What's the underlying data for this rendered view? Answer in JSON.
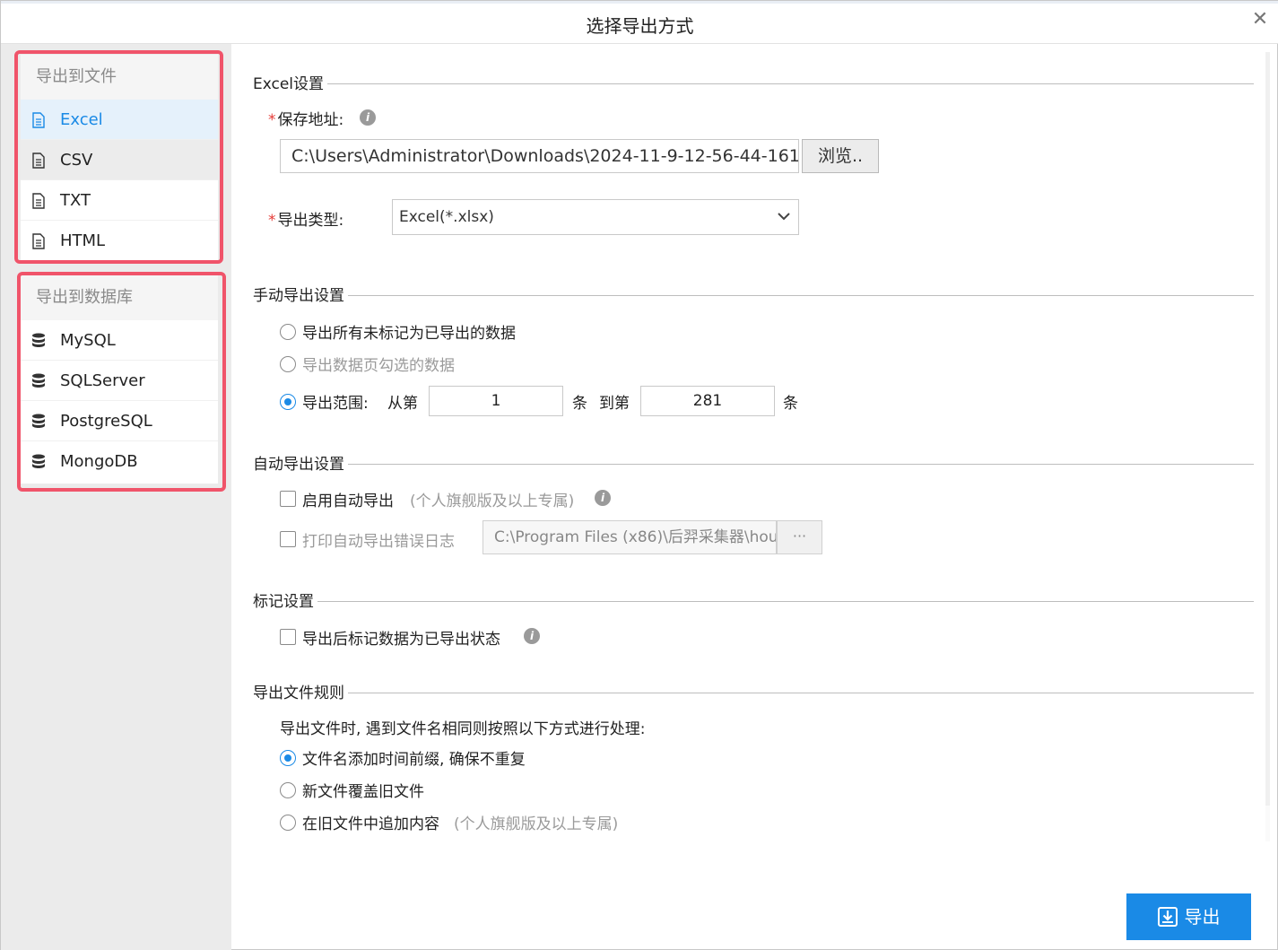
{
  "dialog": {
    "title": "选择导出方式",
    "close_symbol": "✕"
  },
  "sidebar": {
    "file_group": {
      "title": "导出到文件",
      "items": [
        {
          "label": "Excel",
          "icon": "file-icon"
        },
        {
          "label": "CSV",
          "icon": "file-icon"
        },
        {
          "label": "TXT",
          "icon": "file-icon"
        },
        {
          "label": "HTML",
          "icon": "file-icon"
        }
      ]
    },
    "db_group": {
      "title": "导出到数据库",
      "items": [
        {
          "label": "MySQL",
          "icon": "database-icon"
        },
        {
          "label": "SQLServer",
          "icon": "database-icon"
        },
        {
          "label": "PostgreSQL",
          "icon": "database-icon"
        },
        {
          "label": "MongoDB",
          "icon": "database-icon"
        }
      ]
    },
    "highlight_color": "#f0546a"
  },
  "excel_settings": {
    "section_title": "Excel设置",
    "required_mark": "*",
    "save_path_label": "保存地址:",
    "save_path_value": "C:\\Users\\Administrator\\Downloads\\2024-11-9-12-56-44-161",
    "browse_label": "浏览..",
    "export_type_label": "导出类型:",
    "export_type_value": "Excel(*.xlsx)"
  },
  "manual_settings": {
    "section_title": "手动导出设置",
    "option_unmarked": "导出所有未标记为已导出的数据",
    "option_checked": "导出数据页勾选的数据",
    "option_range": "导出范围:",
    "range_from_label": "从第",
    "range_from_value": "1",
    "range_unit": "条",
    "range_to_label": "到第",
    "range_to_value": "281"
  },
  "auto_settings": {
    "section_title": "自动导出设置",
    "enable_label": "启用自动导出",
    "enable_note": "(个人旗舰版及以上专属)",
    "log_label": "打印自动导出错误日志",
    "log_path": "C:\\Program Files (x86)\\后羿采集器\\hou",
    "log_browse": "···"
  },
  "mark_settings": {
    "section_title": "标记设置",
    "mark_label": "导出后标记数据为已导出状态"
  },
  "file_rules": {
    "section_title": "导出文件规则",
    "description": "导出文件时, 遇到文件名相同则按照以下方式进行处理:",
    "option_prefix": "文件名添加时间前缀, 确保不重复",
    "option_overwrite": "新文件覆盖旧文件",
    "option_append": "在旧文件中追加内容",
    "option_append_note": "(个人旗舰版及以上专属)"
  },
  "footer": {
    "export_label": "导出",
    "accent_color": "#1a8ae6"
  }
}
